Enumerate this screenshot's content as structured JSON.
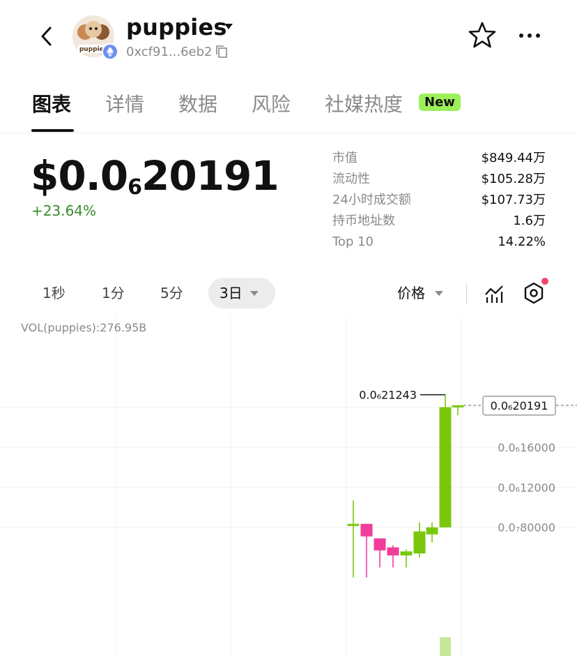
{
  "header": {
    "token_name": "puppies",
    "address": "0xcf91...6eb2",
    "avatar_text": "puppies"
  },
  "tabs": [
    {
      "label": "图表",
      "active": true
    },
    {
      "label": "详情",
      "active": false
    },
    {
      "label": "数据",
      "active": false
    },
    {
      "label": "风险",
      "active": false
    },
    {
      "label": "社媒热度",
      "active": false,
      "badge": "New"
    }
  ],
  "price": {
    "prefix": "$0.0",
    "zeros_subscript": "6",
    "digits": "20191",
    "change": "+23.64%"
  },
  "stats": [
    {
      "label": "市值",
      "value": "$849.44万"
    },
    {
      "label": "流动性",
      "value": "$105.28万"
    },
    {
      "label": "24小时成交额",
      "value": "$107.73万"
    },
    {
      "label": "持币地址数",
      "value": "1.6万"
    },
    {
      "label": "Top 10",
      "value": "14.22%"
    }
  ],
  "timeframes": {
    "items": [
      "1秒",
      "1分",
      "5分"
    ],
    "active": "3日"
  },
  "chart_controls": {
    "price_select": "价格"
  },
  "colors": {
    "up": "#7ac70c",
    "down": "#f03c9a",
    "badge": "#9cf05a",
    "accent_positive": "#3a8a2e"
  },
  "chart_data": {
    "type": "candlestick",
    "volume_label": "VOL(puppies):276.95B",
    "high_marker": {
      "label": "0.0₆21243",
      "value": 2.1243e-07
    },
    "current_price": {
      "label": "0.0₆20191",
      "value": 2.0191e-07
    },
    "y_ticks": [
      {
        "label": "0.0₆20000",
        "value": 2e-07
      },
      {
        "label": "0.0₆16000",
        "value": 1.6e-07
      },
      {
        "label": "0.0₆12000",
        "value": 1.2e-07
      },
      {
        "label": "0.0₇80000",
        "value": 8e-08
      }
    ],
    "candles": [
      {
        "open": 8.35e-08,
        "close": 8.35e-08,
        "high": 1.07e-07,
        "low": 3e-08,
        "dir": "up"
      },
      {
        "open": 8.35e-08,
        "close": 7.1e-08,
        "high": 8.35e-08,
        "low": 3e-08,
        "dir": "down"
      },
      {
        "open": 6.9e-08,
        "close": 5.7e-08,
        "high": 6.9e-08,
        "low": 4e-08,
        "dir": "down"
      },
      {
        "open": 6e-08,
        "close": 5.2e-08,
        "high": 6.2e-08,
        "low": 4e-08,
        "dir": "down"
      },
      {
        "open": 5.2e-08,
        "close": 5.6e-08,
        "high": 5.8e-08,
        "low": 4e-08,
        "dir": "up"
      },
      {
        "open": 5.4e-08,
        "close": 7.6e-08,
        "high": 8.5e-08,
        "low": 5e-08,
        "dir": "up"
      },
      {
        "open": 7.3e-08,
        "close": 8e-08,
        "high": 8.5e-08,
        "low": 6.5e-08,
        "dir": "up"
      },
      {
        "open": 8e-08,
        "close": 2e-07,
        "high": 2.1243e-07,
        "low": 8e-08,
        "dir": "up"
      },
      {
        "open": 2e-07,
        "close": 2.0191e-07,
        "high": 2.02e-07,
        "low": 1.92e-07,
        "dir": "up"
      }
    ]
  }
}
